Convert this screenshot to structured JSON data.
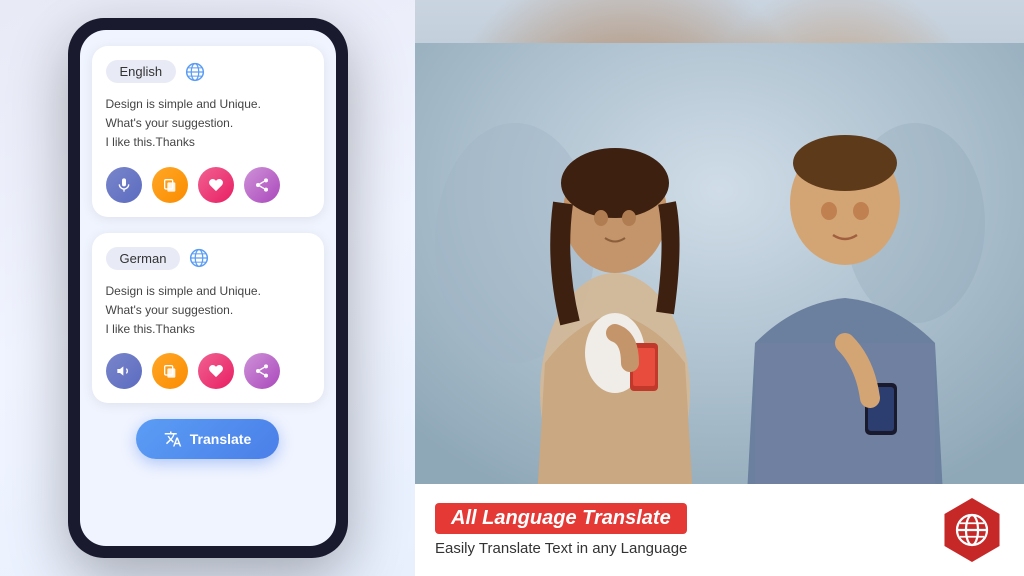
{
  "left_panel": {
    "bg_color": "#e8eaf6"
  },
  "phone": {
    "source_card": {
      "language": "English",
      "text": "Design is simple and Unique.\nWhat's your suggestion.\nI like this.Thanks",
      "actions": [
        "mic",
        "copy",
        "heart",
        "share"
      ]
    },
    "target_card": {
      "language": "German",
      "text": "Design is simple and Unique.\nWhat's your suggestion.\nI like this.Thanks",
      "actions": [
        "speaker",
        "copy",
        "heart",
        "share"
      ]
    },
    "translate_button": "Translate"
  },
  "banner": {
    "title": "All Language Translate",
    "subtitle": "Easily Translate Text in any  Language",
    "icon_alt": "globe-icon"
  }
}
